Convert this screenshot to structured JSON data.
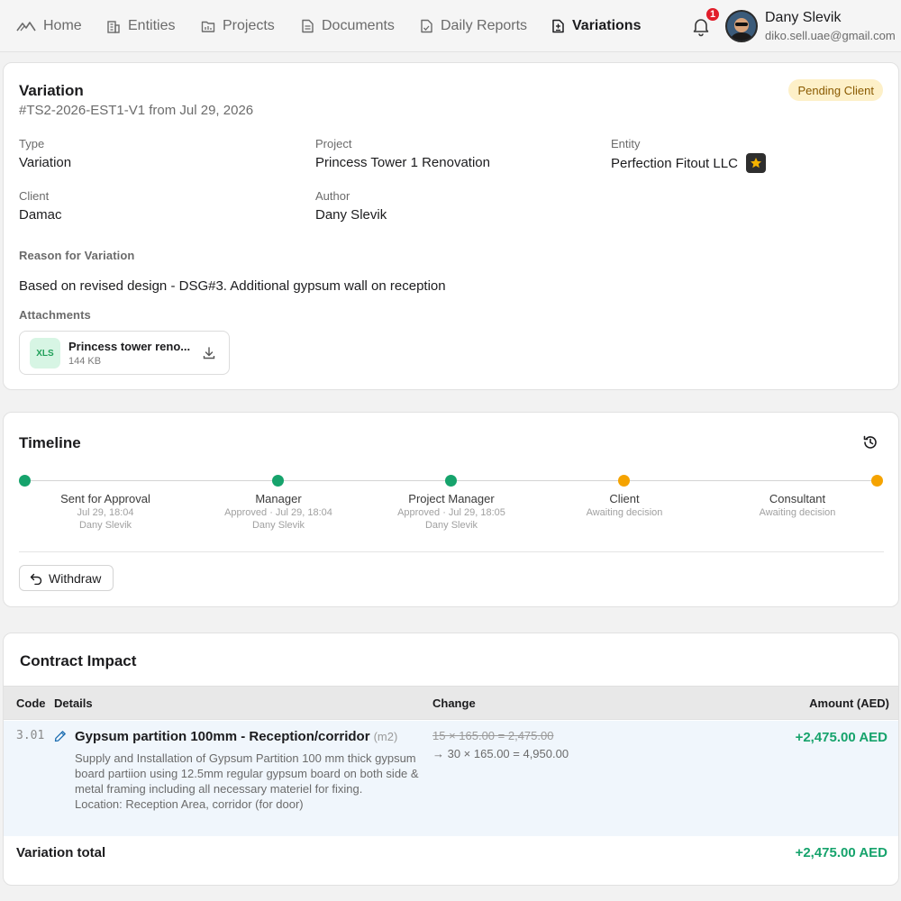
{
  "nav": {
    "items": [
      {
        "label": "Home",
        "icon": "logo-icon"
      },
      {
        "label": "Entities",
        "icon": "building-icon"
      },
      {
        "label": "Projects",
        "icon": "folder-chart-icon"
      },
      {
        "label": "Documents",
        "icon": "document-icon"
      },
      {
        "label": "Daily Reports",
        "icon": "file-check-icon"
      },
      {
        "label": "Variations",
        "icon": "file-diff-icon"
      }
    ],
    "active": "Variations",
    "notification_count": "1",
    "user": {
      "name": "Dany Slevik",
      "email": "diko.sell.uae@gmail.com"
    }
  },
  "variation": {
    "title": "Variation",
    "subtitle": "#TS2-2026-EST1-V1 from Jul 29, 2026",
    "status": "Pending Client",
    "fields": {
      "type_label": "Type",
      "type_value": "Variation",
      "project_label": "Project",
      "project_value": "Princess Tower 1 Renovation",
      "entity_label": "Entity",
      "entity_value": "Perfection Fitout LLC",
      "client_label": "Client",
      "client_value": "Damac",
      "author_label": "Author",
      "author_value": "Dany Slevik"
    },
    "reason_label": "Reason for Variation",
    "reason_text": "Based on revised design - DSG#3. Additional gypsum wall on reception",
    "attachments_label": "Attachments",
    "attachment": {
      "type": "XLS",
      "name": "Princess tower reno...",
      "size": "144 KB"
    }
  },
  "timeline": {
    "title": "Timeline",
    "steps": [
      {
        "name": "Sent for Approval",
        "meta": "Jul 29, 18:04",
        "by": "Dany Slevik",
        "state": "done"
      },
      {
        "name": "Manager",
        "meta": "Approved · Jul 29, 18:04",
        "by": "Dany Slevik",
        "state": "done"
      },
      {
        "name": "Project Manager",
        "meta": "Approved · Jul 29, 18:05",
        "by": "Dany Slevik",
        "state": "done"
      },
      {
        "name": "Client",
        "meta": "Awaiting decision",
        "by": "",
        "state": "pending"
      },
      {
        "name": "Consultant",
        "meta": "Awaiting decision",
        "by": "",
        "state": "pending"
      }
    ],
    "withdraw_label": "Withdraw",
    "colors": {
      "done": "#16a36c",
      "pending": "#f5a300"
    }
  },
  "contract": {
    "title": "Contract Impact",
    "headers": {
      "code": "Code",
      "details": "Details",
      "change": "Change",
      "amount": "Amount (AED)"
    },
    "row": {
      "code": "3.01",
      "title": "Gypsum partition 100mm - Reception/corridor",
      "unit": "(m2)",
      "description": "Supply and Installation of Gypsum Partition 100 mm thick gypsum board partiion using 12.5mm regular gypsum board on both side & metal framing including all necessary materiel for fixing.",
      "location": "Location: Reception Area, corridor (for door)",
      "change_old": "15 × 165.00 = 2,475.00",
      "change_new": "→ 30 × 165.00 = 4,950.00",
      "amount": "+2,475.00 AED"
    },
    "total_label": "Variation total",
    "total_value": "+2,475.00 AED"
  }
}
